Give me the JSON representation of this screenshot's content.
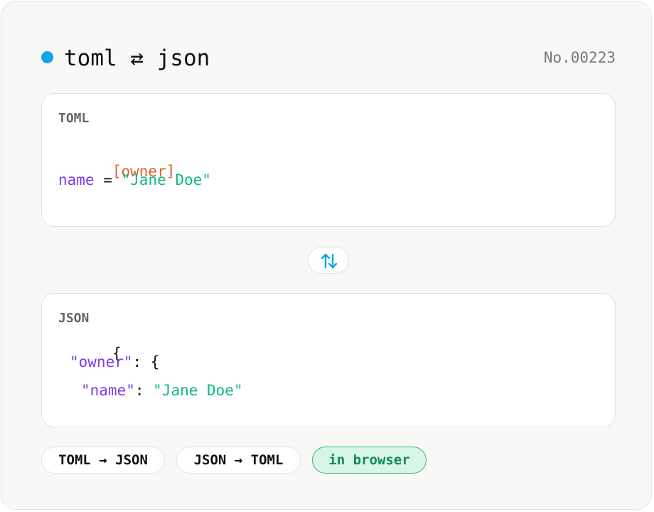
{
  "header": {
    "title": "toml ⇄ json",
    "serial": "No.00223",
    "accent_color": "#0ea5e9"
  },
  "toml_panel": {
    "label": "TOML",
    "lines": {
      "table": "[owner]",
      "key": "name",
      "eq": " = ",
      "value": "\"Jane Doe\""
    }
  },
  "swap_button": {
    "icon": "swap-vertical-arrows-icon"
  },
  "json_panel": {
    "label": "JSON",
    "lines": {
      "open_brace": "{",
      "owner_key": "\"owner\"",
      "owner_sep": ": {",
      "name_key": "\"name\"",
      "name_sep": ": ",
      "name_value": "\"Jane Doe\"",
      "close_inner": "}"
    }
  },
  "chips": {
    "toml_to_json": "TOML → JSON",
    "json_to_toml": "JSON → TOML",
    "in_browser": "in browser"
  },
  "colors": {
    "table": "#d9622b",
    "key": "#7c3aed",
    "string": "#10b981",
    "chip_accent_bg": "#d7f5e8",
    "chip_accent_text": "#118a57"
  }
}
